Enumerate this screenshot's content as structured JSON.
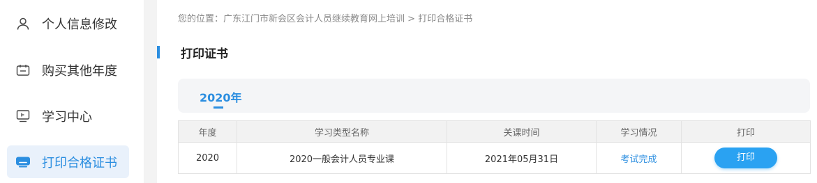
{
  "sidebar": {
    "items": [
      {
        "label": "个人信息修改",
        "icon": "user-icon"
      },
      {
        "label": "购买其他年度",
        "icon": "calendar-card-icon"
      },
      {
        "label": "学习中心",
        "icon": "monitor-icon"
      },
      {
        "label": "打印合格证书",
        "icon": "certificate-card-icon",
        "active": true
      }
    ]
  },
  "breadcrumb": {
    "prefix": "您的位置：",
    "site": "广东江门市新会区会计人员继续教育网上培训",
    "separator": " > ",
    "current": "打印合格证书"
  },
  "page": {
    "title": "打印证书"
  },
  "year_tabs": {
    "active_label": "2020年"
  },
  "table": {
    "headers": [
      "年度",
      "学习类型名称",
      "关课时间",
      "学习情况",
      "打印"
    ],
    "rows": [
      {
        "year": "2020",
        "course": "2020一般会计人员专业课",
        "close_time": "2021年05月31日",
        "status": "考试完成",
        "action": "打印"
      }
    ]
  },
  "colors": {
    "accent": "#2b8ee0",
    "button": "#2aa2f2",
    "active_bg": "#e9f1fb"
  }
}
